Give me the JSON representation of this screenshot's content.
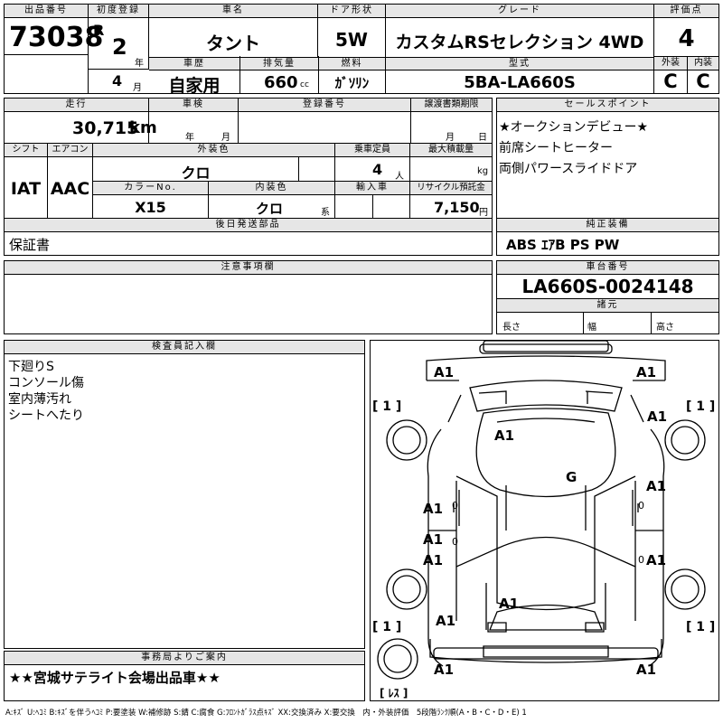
{
  "top": {
    "lot_label": "出品番号",
    "lot_no": "73038",
    "reg_label": "初度登録",
    "era": "R",
    "year": "2",
    "year_unit": "年",
    "month": "4",
    "month_unit": "月",
    "name_label": "車名",
    "name": "タント",
    "door_label": "ドア形状",
    "door": "5W",
    "grade_label": "グレード",
    "grade": "カスタムRSセレクション 4WD",
    "score_label": "評価点",
    "score": "4",
    "history_label": "車歴",
    "history": "自家用",
    "disp_label": "排気量",
    "disp": "660",
    "disp_unit": "cc",
    "fuel_label": "燃料",
    "fuel": "ｶﾞｿﾘﾝ",
    "model_label": "型式",
    "model": "5BA-LA660S",
    "ext_label": "外装",
    "ext": "C",
    "int_label": "内装",
    "int": "C"
  },
  "mid": {
    "mileage_label": "走行",
    "mileage": "30,715",
    "mileage_unit": "km",
    "inspection_label": "車検",
    "insp_year_unit": "年",
    "insp_month_unit": "月",
    "regno_label": "登録番号",
    "deadline_label": "譲渡書類期限",
    "dl_month_unit": "月",
    "dl_day_unit": "日",
    "shift_label": "シフト",
    "shift": "IAT",
    "ac_label": "エアコン",
    "ac": "AAC",
    "color_label": "外装色",
    "color": "クロ",
    "seats_label": "乗車定員",
    "seats": "4",
    "seats_unit": "人",
    "load_label": "最大積載量",
    "load_unit": "kg",
    "colorno_label": "カラーNo.",
    "colorno": "X15",
    "intcolor_label": "内装色",
    "intcolor": "クロ",
    "intcolor_unit": "系",
    "import_label": "輸入車",
    "recycle_label": "リサイクル預託金",
    "recycle": "7,150",
    "recycle_unit": "円",
    "later_label": "後日発送部品",
    "later": "保証書"
  },
  "right": {
    "sales_label": "セールスポイント",
    "sales": [
      "★オークションデビュー★",
      "前席シートヒーター",
      "両側パワースライドドア"
    ],
    "equip_label": "純正装備",
    "equip": "ABS ｴｱB PS PW",
    "chassis_label": "車台番号",
    "chassis": "LA660S-0024148",
    "dims_label": "諸元",
    "length_label": "長さ",
    "width_label": "幅",
    "height_label": "高さ"
  },
  "notes": {
    "label": "注意事項欄"
  },
  "inspector": {
    "label": "検査員記入欄",
    "lines": [
      "下廻りS",
      "コンソール傷",
      "室内薄汚れ",
      "シートへたり"
    ]
  },
  "office": {
    "label": "事務局よりご案内",
    "text": "★★宮城サテライト会場出品車★★"
  },
  "diagram": {
    "marks": [
      "A1",
      "A1",
      "A1",
      "A1",
      "G",
      "A1",
      "A1",
      "A1",
      "A1",
      "A1",
      "A1",
      "A1",
      "A1",
      "A1"
    ],
    "tires": [
      "[ 1 ]",
      "[ 1 ]",
      "[ 1 ]",
      "[ 1 ]"
    ],
    "spare": "[ ﾚｽ ]"
  },
  "legend": "A:ｷｽﾞ U:ﾍｺﾐ B:ｷｽﾞを伴うﾍｺﾐ P:要塗装 W:補修跡 S:錆 C:腐食 G:ﾌﾛﾝﾄｶﾞﾗｽ点ｷｽﾞ XX:交換済み X:要交換　内・外装評価　5段階ﾗﾝｸ順(A・B・C・D・E) 1"
}
